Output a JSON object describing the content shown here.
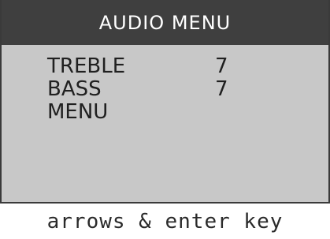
{
  "screen": {
    "title": "AUDIO MENU",
    "items": [
      {
        "label": "TREBLE",
        "value": "7"
      },
      {
        "label": "BASS",
        "value": "7"
      },
      {
        "label": "MENU",
        "value": ""
      }
    ]
  },
  "footer": {
    "hint": "arrows & enter key"
  },
  "colors": {
    "title_bar": "#3f3f3f",
    "title_text": "#ffffff",
    "screen_bg": "#c8c8c8",
    "text": "#202020",
    "footer_bg": "#ffffff"
  }
}
